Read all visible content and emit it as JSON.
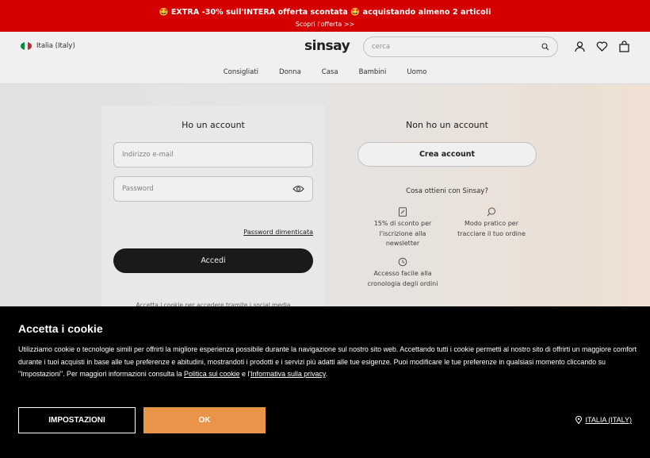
{
  "promo": {
    "text": "🤩 EXTRA -30% sull'INTERA offerta scontata 🤩 acquistando almeno 2 articoli",
    "link": "Scopri l'offerta >>"
  },
  "header": {
    "country": "Italia (Italy)",
    "logo": "sinsay",
    "search_placeholder": "cerca",
    "flag_colors": [
      "#009246",
      "#ffffff",
      "#ce2b37"
    ],
    "icons": [
      "user-icon",
      "heart-icon",
      "cart-icon"
    ]
  },
  "nav": [
    "Consigliati",
    "Donna",
    "Casa",
    "Bambini",
    "Uomo"
  ],
  "login": {
    "title": "Ho un account",
    "email_placeholder": "Indirizzo e-mail",
    "password_placeholder": "Password",
    "forgot": "Password dimenticata",
    "submit": "Accedi",
    "social_note": "Accetta i cookie per accedere tramite i social media"
  },
  "register": {
    "title": "Non ho un account",
    "button": "Crea account",
    "benefits_question": "Cosa ottieni con Sinsay?",
    "benefits": [
      {
        "icon": "discount-icon",
        "text": "15% di sconto per l'iscrizione alla newsletter"
      },
      {
        "icon": "search-pin-icon",
        "text": "Modo pratico per tracciare il tuo ordine"
      },
      {
        "icon": "history-icon",
        "text": "Accesso facile alla cronologia degli ordini"
      }
    ]
  },
  "cookie": {
    "title": "Accetta i cookie",
    "text_1": "Utilizziamo cookie o tecnologie simili per offrirti la migliore esperienza possibile durante la navigazione sul nostro sito web. Accettando tutti i cookie permetti al nostro sito di offrirti un maggiore comfort durante i tuoi acquisti in base alle tue preferenze e abitudini, mostrandoti i prodotti e i servizi più adatti alle tue esigenze. Puoi modificare le tue preferenze in qualsiasi momento cliccando su \"Impostazioni\". Per maggiori informazioni consulta la ",
    "link_1": "Politica sui cookie",
    "text_2": " e l'",
    "link_2": "Informativa sulla privacy",
    "text_3": ".",
    "settings_button": "IMPOSTAZIONI",
    "ok_button": "OK",
    "country": "ITALIA (ITALY)",
    "ok_color": "#e8954a"
  }
}
